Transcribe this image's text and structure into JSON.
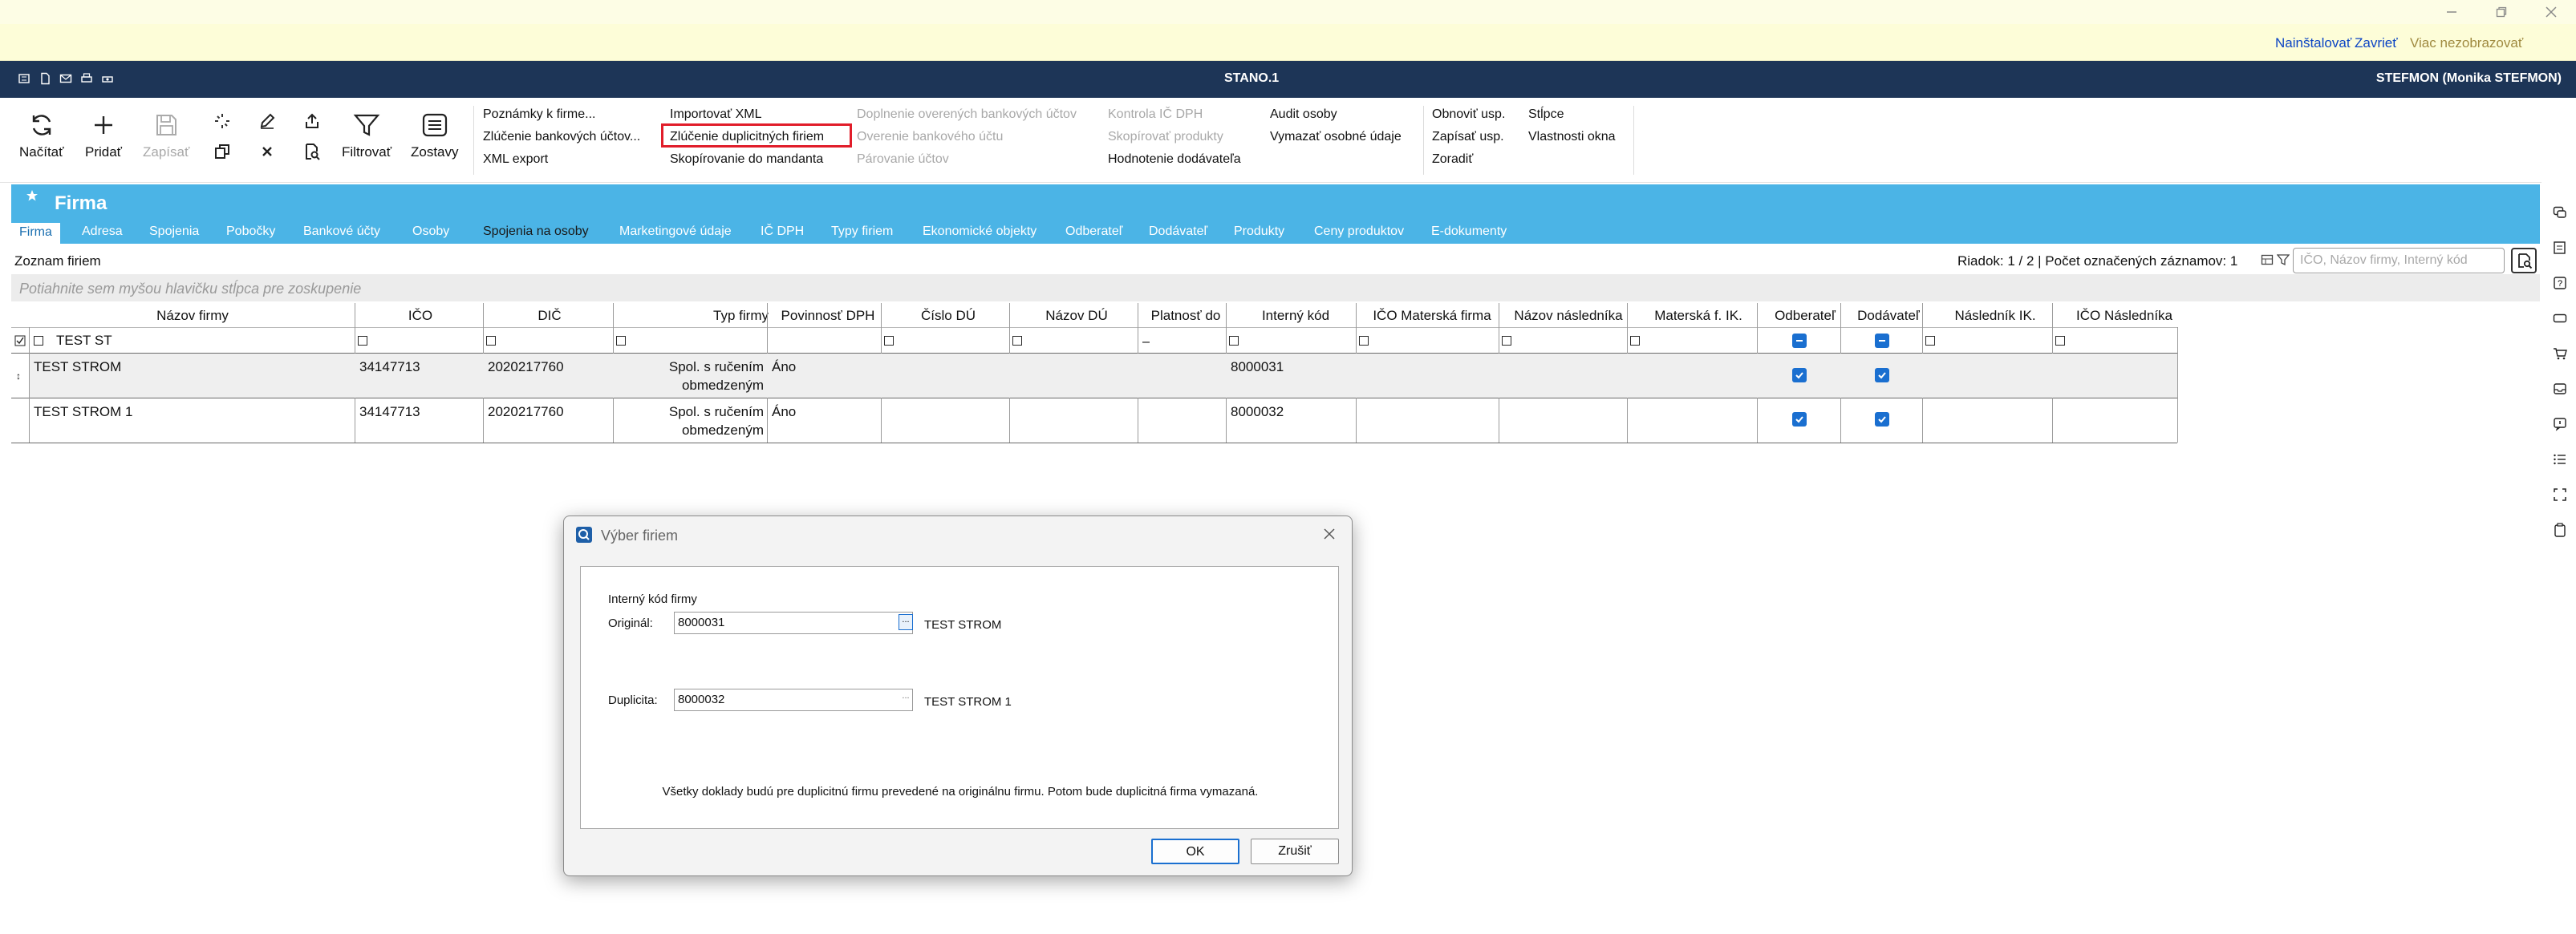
{
  "infobar": {
    "install": "Nainštalovať",
    "close": "Zavrieť",
    "more": "Viac nezobrazovať"
  },
  "app": {
    "title": "STANO.1",
    "user": "STEFMON (Monika STEFMON)"
  },
  "toolbar": {
    "buttons": [
      {
        "label": "Načítať",
        "icon": "refresh-icon"
      },
      {
        "label": "Pridať",
        "icon": "plus-icon"
      },
      {
        "label": "Zapísať",
        "icon": "save-icon",
        "disabled": true
      },
      {
        "label": "Filtrovať",
        "icon": "filter-icon"
      },
      {
        "label": "Zostavy",
        "icon": "reports-icon"
      }
    ],
    "menu_col1": [
      "Poznámky k firme...",
      "Zlúčenie bankových účtov...",
      "XML export"
    ],
    "menu_col2": [
      "Importovať XML",
      "Zlúčenie duplicitných firiem",
      "Skopírovanie do mandanta"
    ],
    "menu_col3": [
      "Doplnenie overených bankových účtov",
      "Overenie bankového účtu",
      "Párovanie účtov"
    ],
    "menu_col4": [
      "Kontrola IČ DPH",
      "Skopírovať produkty",
      "Hodnotenie dodávateľa"
    ],
    "menu_col5": [
      "Audit osoby",
      "Vymazať osobné údaje"
    ],
    "menu_col6": [
      "Obnoviť usp.",
      "Zapísať usp.",
      "Zoradiť"
    ],
    "menu_col7": [
      "Stĺpce",
      "Vlastnosti okna"
    ]
  },
  "header": {
    "title": "Firma",
    "tabs": [
      "Firma",
      "Adresa",
      "Spojenia",
      "Pobočky",
      "Bankové účty",
      "Osoby",
      "Spojenia na osoby",
      "Marketingové údaje",
      "IČ DPH",
      "Typy firiem",
      "Ekonomické objekty",
      "Odberateľ",
      "Dodávateľ",
      "Produkty",
      "Ceny produktov",
      "E-dokumenty"
    ]
  },
  "list": {
    "title": "Zoznam firiem",
    "status": "Riadok: 1 / 2 | Počet označených záznamov: 1",
    "search_placeholder": "IČO, Názov firmy, Interný kód",
    "group_hint": "Potiahnite sem myšou hlavičku stĺpca pre zoskupenie",
    "columns": [
      "Názov firmy",
      "IČO",
      "DIČ",
      "Typ firmy",
      "Povinnosť DPH",
      "Číslo DÚ",
      "Názov DÚ",
      "Platnosť do",
      "Interný kód",
      "IČO Materská firma",
      "Názov následníka",
      "Materská f. IK.",
      "Odberateľ",
      "Dodávateľ",
      "Následník IK.",
      "IČO Následníka"
    ],
    "filter": {
      "name": "TEST ST",
      "platnost": "–"
    },
    "rows": [
      {
        "name": "TEST STROM",
        "ico": "34147713",
        "dic": "2020217760",
        "type1": "Spol. s ručením",
        "type2": "obmedzeným",
        "dph": "Áno",
        "code": "8000031",
        "odberatel": true,
        "dodavatel": true
      },
      {
        "name": "TEST STROM 1",
        "ico": "34147713",
        "dic": "2020217760",
        "type1": "Spol. s ručením",
        "type2": "obmedzeným",
        "dph": "Áno",
        "code": "8000032",
        "odberatel": true,
        "dodavatel": true
      }
    ]
  },
  "dialog": {
    "title": "Výber firiem",
    "section": "Interný kód firmy",
    "original_label": "Originál:",
    "original_value": "8000031",
    "original_name": "TEST STROM",
    "duplicate_label": "Duplicita:",
    "duplicate_value": "8000032",
    "duplicate_name": "TEST STROM 1",
    "note": "Všetky doklady budú pre duplicitnú firmu prevedené na originálnu firmu. Potom bude duplicitná firma vymazaná.",
    "ok": "OK",
    "cancel": "Zrušiť"
  },
  "colors": {
    "appbar": "#1d3557",
    "blue": "#4bb4e6",
    "highlight": "#e11d2a",
    "checkbox": "#1a6fd0"
  }
}
